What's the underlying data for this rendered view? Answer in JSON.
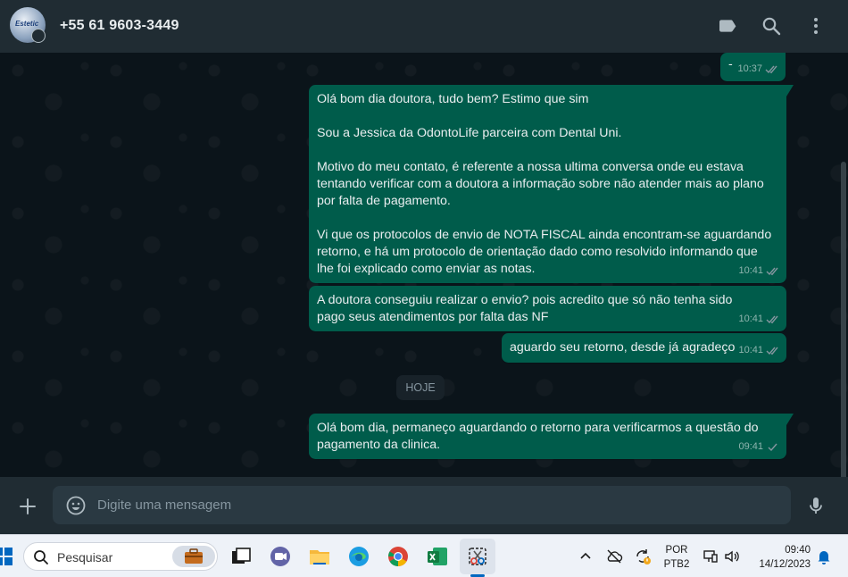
{
  "header": {
    "contact_name": "+55 61 9603-3449",
    "avatar_logo_text": "Estetic"
  },
  "messages": [
    {
      "text": "-",
      "time": "10:37",
      "status": "read"
    },
    {
      "text": "Olá bom dia doutora, tudo bem? Estimo que sim\n\nSou a Jessica da OdontoLife parceira com Dental Uni.\n\nMotivo do meu contato, é referente a nossa ultima conversa onde eu estava tentando verificar com a doutora a informação sobre não atender mais ao plano por falta de pagamento.\n\nVi que os protocolos de envio de NOTA FISCAL ainda encontram-se aguardando retorno, e há um protocolo de orientação dado como resolvido informando que lhe foi explicado como enviar as notas.",
      "time": "10:41",
      "status": "read"
    },
    {
      "text": "A doutora conseguiu realizar o envio? pois acredito que só não tenha sido pago seus atendimentos por falta das NF",
      "time": "10:41",
      "status": "read"
    },
    {
      "text": "aguardo seu retorno, desde já agradeço",
      "time": "10:41",
      "status": "read"
    },
    {
      "text": "Olá bom dia, permaneço aguardando o retorno para verificarmos a questão do pagamento da clinica.",
      "time": "09:41",
      "status": "sent"
    }
  ],
  "day_divider": "HOJE",
  "composer": {
    "placeholder": "Digite uma mensagem"
  },
  "taskbar": {
    "search_placeholder": "Pesquisar",
    "language_line1": "POR",
    "language_line2": "PTB2",
    "time": "09:40",
    "date": "14/12/2023"
  },
  "colors": {
    "outgoing_bubble": "#005c4b",
    "header_bg": "#202c33",
    "chat_bg": "#0b141a",
    "read_tick": "#8696a0"
  }
}
